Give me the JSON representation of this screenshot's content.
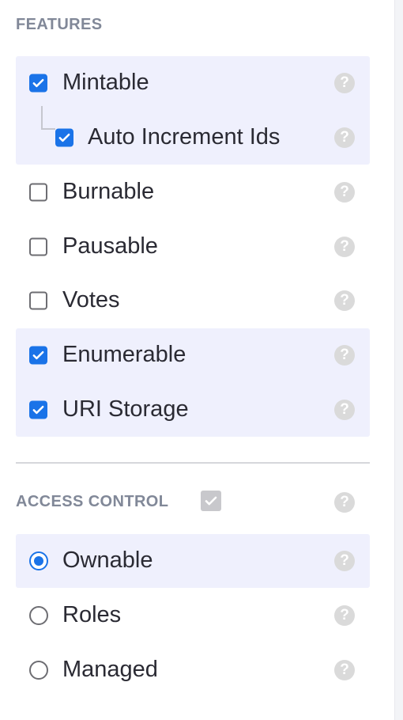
{
  "features": {
    "heading": "FEATURES",
    "items": [
      {
        "label": "Mintable",
        "checked": true
      },
      {
        "label": "Auto Increment Ids",
        "checked": true,
        "nested": true
      },
      {
        "label": "Burnable",
        "checked": false
      },
      {
        "label": "Pausable",
        "checked": false
      },
      {
        "label": "Votes",
        "checked": false
      },
      {
        "label": "Enumerable",
        "checked": true
      },
      {
        "label": "URI Storage",
        "checked": true
      }
    ]
  },
  "access_control": {
    "heading": "ACCESS CONTROL",
    "enabled": true,
    "options": [
      {
        "label": "Ownable",
        "selected": true
      },
      {
        "label": "Roles",
        "selected": false
      },
      {
        "label": "Managed",
        "selected": false
      }
    ]
  },
  "help_glyph": "?",
  "colors": {
    "accent": "#1a73e8",
    "selected_row_bg": "#eff0fd",
    "heading": "#818898",
    "help_icon": "#dadada"
  }
}
